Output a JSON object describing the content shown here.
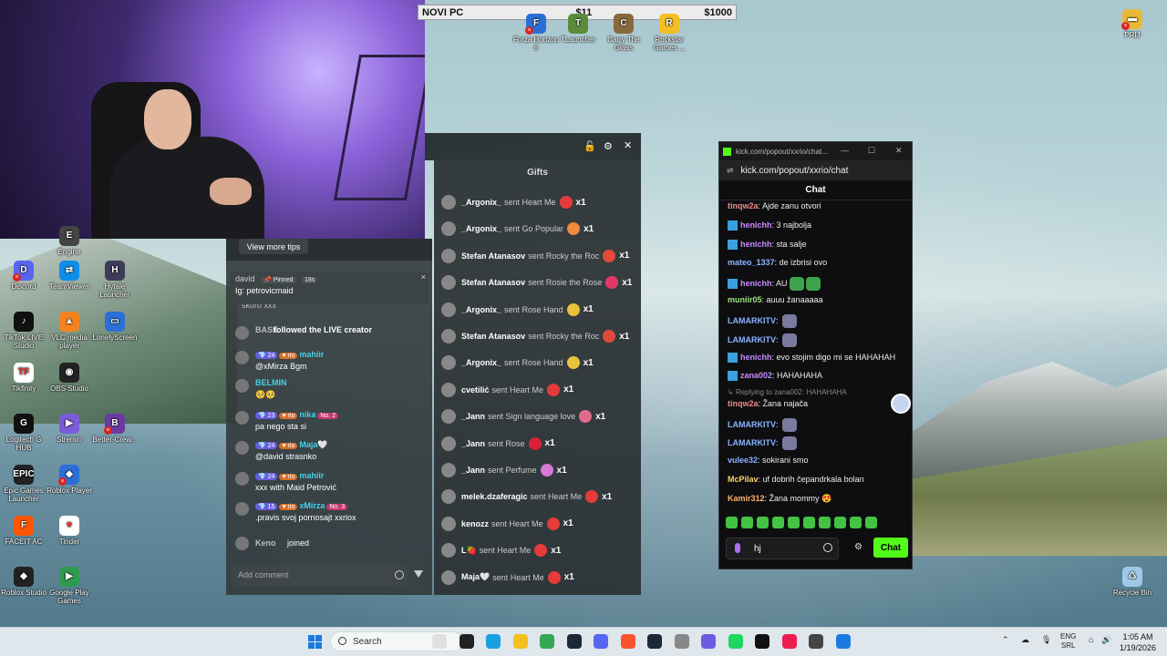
{
  "topbar": {
    "left": "NOVI PC",
    "middle": "$11",
    "right": "$1000"
  },
  "desktop_icons": [
    {
      "label": "Forza Horizon 5",
      "color": "#2b6fd6",
      "glyph": "F"
    },
    {
      "label": "TLauncher",
      "color": "#5b8c3a",
      "glyph": "T"
    },
    {
      "label": "Carry The Glass",
      "color": "#8a6a3a",
      "glyph": "C"
    },
    {
      "label": "Rockstar Games ...",
      "color": "#f4c021",
      "glyph": "R"
    },
    {
      "label": "PRIJ",
      "color": "#e8b938",
      "glyph": "▬"
    },
    {
      "label": "Engine",
      "color": "#444",
      "glyph": "E"
    },
    {
      "label": "Discord",
      "color": "#5865f2",
      "glyph": "D"
    },
    {
      "label": "TeamViewer",
      "color": "#0e8ee9",
      "glyph": "⇄"
    },
    {
      "label": "Hytale Launcher",
      "color": "#3c3c5a",
      "glyph": "H"
    },
    {
      "label": "TikTok LIVE Studio",
      "color": "#111",
      "glyph": "♪"
    },
    {
      "label": "VLC media player",
      "color": "#f58220",
      "glyph": "▲"
    },
    {
      "label": "LonelyScreen",
      "color": "#2b6fd6",
      "glyph": "▭"
    },
    {
      "label": "Tikfinity",
      "color": "#fff",
      "glyph": "TF"
    },
    {
      "label": "OBS Studio",
      "color": "#222",
      "glyph": "◉"
    },
    {
      "label": "Logitech G HUB",
      "color": "#111",
      "glyph": "G"
    },
    {
      "label": "Stremio",
      "color": "#7b5bd6",
      "glyph": "▶"
    },
    {
      "label": "Better-Crew...",
      "color": "#6a3aa0",
      "glyph": "B"
    },
    {
      "label": "Epic Games Launcher",
      "color": "#222",
      "glyph": "EPIC"
    },
    {
      "label": "Roblox Player",
      "color": "#2b6fd6",
      "glyph": "◆"
    },
    {
      "label": "FACEIT AC",
      "color": "#ff5500",
      "glyph": "F"
    },
    {
      "label": "Tinder",
      "color": "#fff",
      "glyph": "♥"
    },
    {
      "label": "Roblox Studio",
      "color": "#222",
      "glyph": "◆"
    },
    {
      "label": "Google Play Games",
      "color": "#2e9a4d",
      "glyph": "▶"
    },
    {
      "label": "Recycle Bin",
      "color": "#9ecae8",
      "glyph": "♺"
    }
  ],
  "tiktok": {
    "tips_button": "View more tips",
    "pinned": {
      "user": "david",
      "tag": "📌 Pinned",
      "time": "18s",
      "text": "Ig: petrovicmaid"
    },
    "faded_text": "skoro xxx",
    "messages": [
      {
        "name": "BASE",
        "text": "followed the LIVE creator",
        "lvl": "",
        "sub": "",
        "rank": ""
      },
      {
        "name": "mahiir",
        "text": "@xMirza Bgm",
        "lvl": "💎 24",
        "sub": "♥ rio",
        "rank": ""
      },
      {
        "name": "BELMIN",
        "text": "🥺🥺",
        "lvl": "",
        "sub": "",
        "rank": ""
      },
      {
        "name": "nika",
        "text": "pa nego sta si",
        "lvl": "💎 23",
        "sub": "♥ rio",
        "rank": "No. 2"
      },
      {
        "name": "Maja🤍",
        "text": "@david strasnko",
        "lvl": "💎 24",
        "sub": "♥ rio",
        "rank": ""
      },
      {
        "name": "mahiir",
        "text": "xxx with Maid Petrović",
        "lvl": "💎 24",
        "sub": "♥ rio",
        "rank": ""
      },
      {
        "name": "xMirza",
        "text": ".pravis svoj pornosajt xxriox",
        "lvl": "💎 15",
        "sub": "♥ rio",
        "rank": "No. 3"
      }
    ],
    "joined": {
      "name": "Keno",
      "text": "joined"
    },
    "add_comment_placeholder": "Add comment"
  },
  "gifts": {
    "title": "Gifts",
    "rows": [
      {
        "name": "_Argonix_",
        "action": "sent Heart Me",
        "count": "x1",
        "color": "#e53b3b"
      },
      {
        "name": "_Argonix_",
        "action": "sent Go Popular",
        "count": "x1",
        "color": "#f08a3c"
      },
      {
        "name": "Stefan Atanasov",
        "action": "sent Rocky the Roc",
        "count": "x1",
        "color": "#e04a3a"
      },
      {
        "name": "Stefan Atanasov",
        "action": "sent Rosie the Rose",
        "count": "x1",
        "color": "#e2386a"
      },
      {
        "name": "_Argonix_",
        "action": "sent Rose Hand",
        "count": "x1",
        "color": "#e8c23a"
      },
      {
        "name": "Stefan Atanasov",
        "action": "sent Rocky the Roc",
        "count": "x1",
        "color": "#e04a3a"
      },
      {
        "name": "_Argonix_",
        "action": "sent Rose Hand",
        "count": "x1",
        "color": "#e8c23a"
      },
      {
        "name": "cvetiliċ",
        "action": "sent Heart Me",
        "count": "x1",
        "color": "#e53b3b"
      },
      {
        "name": "_Jann",
        "action": "sent Sign language love",
        "count": "x1",
        "color": "#e06a8a"
      },
      {
        "name": "_Jann",
        "action": "sent Rose",
        "count": "x1",
        "color": "#d8203a"
      },
      {
        "name": "_Jann",
        "action": "sent Perfume",
        "count": "x1",
        "color": "#d67ad8"
      },
      {
        "name": "melek.dzaferagic",
        "action": "sent Heart Me",
        "count": "x1",
        "color": "#e53b3b"
      },
      {
        "name": "kenozz",
        "action": "sent Heart Me",
        "count": "x1",
        "color": "#e53b3b"
      },
      {
        "name": "L🍓",
        "action": "sent Heart Me",
        "count": "x1",
        "color": "#e53b3b"
      },
      {
        "name": "Maja🤍",
        "action": "sent Heart Me",
        "count": "x1",
        "color": "#e53b3b"
      }
    ]
  },
  "kick": {
    "title": "kick.com/popout/xxrio/chat...",
    "url": "kick.com/popout/xxrio/chat",
    "chat_header": "Chat",
    "messages": [
      {
        "name": "tinqw2a",
        "text": "Ajde zanu otvori",
        "color": "#f08a8a",
        "badge": false,
        "emotes": 0
      },
      {
        "name": "henichh",
        "text": "3 najbolja",
        "color": "#c88cff",
        "badge": true,
        "emotes": 0
      },
      {
        "name": "henichh",
        "text": "sta salje",
        "color": "#c88cff",
        "badge": true,
        "emotes": 0
      },
      {
        "name": "mateo_1337",
        "text": "de izbrisi ovo",
        "color": "#8ab4ff",
        "badge": false,
        "emotes": 0
      },
      {
        "name": "henichh",
        "text": "AU",
        "color": "#c88cff",
        "badge": true,
        "emotes": 2
      },
      {
        "name": "muniir05",
        "text": "auuu žanaaaaa",
        "color": "#9be37b",
        "badge": false,
        "emotes": 0
      },
      {
        "name": "LAMARKITV",
        "text": "",
        "color": "#8ab4ff",
        "badge": false,
        "emotes": 1
      },
      {
        "name": "LAMARKITV",
        "text": "",
        "color": "#8ab4ff",
        "badge": false,
        "emotes": 1
      },
      {
        "name": "henichh",
        "text": "evo stojim digo mi se HAHAHAH",
        "color": "#c88cff",
        "badge": true,
        "emotes": 0
      },
      {
        "name": "zana002",
        "text": "HAHAHAHA",
        "color": "#c88cff",
        "badge": true,
        "emotes": 0
      },
      {
        "name": "tinqw2a",
        "text": "Žana najača",
        "color": "#f08a8a",
        "badge": false,
        "emotes": 0,
        "reply": "↳ Replying to zana002: HAHAHAHA"
      },
      {
        "name": "LAMARKITV",
        "text": "",
        "color": "#8ab4ff",
        "badge": false,
        "emotes": 1
      },
      {
        "name": "LAMARKITV",
        "text": "",
        "color": "#8ab4ff",
        "badge": false,
        "emotes": 1
      },
      {
        "name": "vulee32",
        "text": "sokirani smo",
        "color": "#8ab4ff",
        "badge": false,
        "emotes": 0
      },
      {
        "name": "McPilav",
        "text": "uf dobrih čepandrkala bolan",
        "color": "#ffd36a",
        "badge": false,
        "emotes": 0
      },
      {
        "name": "Kamir312",
        "text": "Žana mommy 😍",
        "color": "#ffb36a",
        "badge": false,
        "emotes": 0
      }
    ],
    "input_value": "hj",
    "send_label": "Chat"
  },
  "taskbar": {
    "search_placeholder": "Search",
    "lang_top": "ENG",
    "lang_bottom": "SRL",
    "time": "1:05 AM",
    "date": "1/19/2026",
    "apps": [
      "#e0e0e0",
      "#222",
      "#1aa0e0",
      "#f4c021",
      "#34a853",
      "#1b2838",
      "#5865f2",
      "#fb542b",
      "#1b2838",
      "#888",
      "#6a5be0",
      "#1ed760",
      "#111",
      "#ee1d52",
      "#444",
      "#1a7ae0"
    ]
  }
}
